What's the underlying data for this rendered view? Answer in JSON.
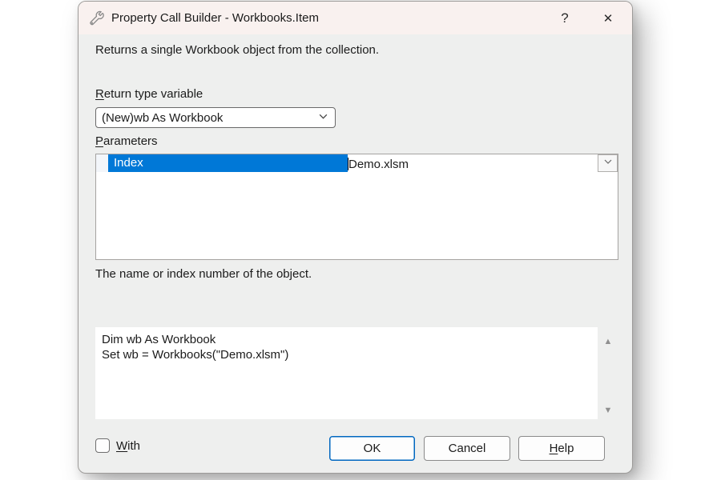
{
  "window": {
    "title": "Property Call Builder - Workbooks.Item",
    "help_glyph": "?",
    "close_glyph": "✕"
  },
  "description": "Returns a single Workbook object from the collection.",
  "return_type": {
    "label_accel": "R",
    "label_rest": "eturn type variable",
    "selected_value": "(New)wb As Workbook"
  },
  "parameters": {
    "label_accel": "P",
    "label_rest": "arameters",
    "rows": [
      {
        "name": "Index",
        "value": "Demo.xlsm"
      }
    ],
    "hint": "The name or index number of the object."
  },
  "code_preview": {
    "lines": [
      "Dim wb As Workbook",
      "Set wb = Workbooks(\"Demo.xlsm\")"
    ],
    "scroll_up_glyph": "▲",
    "scroll_down_glyph": "▼"
  },
  "with_checkbox": {
    "label_accel": "W",
    "label_rest": "ith",
    "checked": false
  },
  "buttons": {
    "ok": "OK",
    "cancel": "Cancel",
    "help_accel": "H",
    "help_rest": "elp"
  },
  "colors": {
    "selection_blue": "#0078d7",
    "ok_button_border": "#0067c0",
    "titlebar_bg": "#f9f1ef",
    "body_bg": "#eeefee"
  }
}
